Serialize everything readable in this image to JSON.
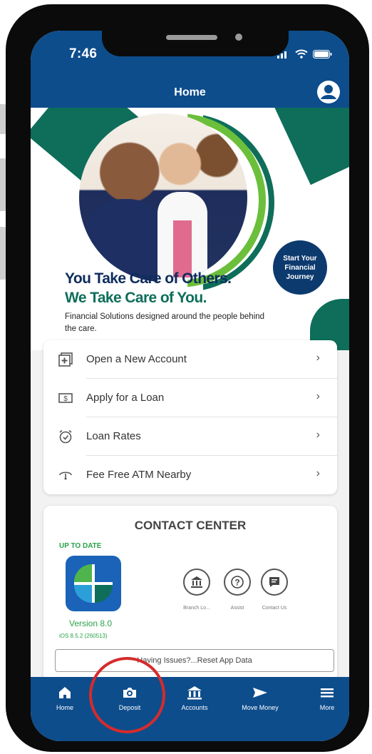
{
  "status_bar": {
    "time": "7:46"
  },
  "header": {
    "title": "Home"
  },
  "hero": {
    "headline_line1": "You Take Care of Others.",
    "headline_line2": "We Take Care of You.",
    "subtitle": "Financial Solutions designed around the people behind the care.",
    "badge_text": "Start Your Financial Journey"
  },
  "quick_links": [
    {
      "label": "Open a New Account",
      "icon": "add-account-icon"
    },
    {
      "label": "Apply for a Loan",
      "icon": "dollar-bill-icon"
    },
    {
      "label": "Loan Rates",
      "icon": "alarm-clock-icon"
    },
    {
      "label": "Fee Free ATM Nearby",
      "icon": "location-icon"
    }
  ],
  "contact_center": {
    "title": "CONTACT CENTER",
    "status": "UP TO DATE",
    "version": "Version 8.0",
    "ios_version": "iOS 8.5.2 (260513)",
    "actions": [
      {
        "label": "Branch Lo...",
        "icon": "bank-icon"
      },
      {
        "label": "Assist",
        "icon": "help-icon"
      },
      {
        "label": "Contact Us",
        "icon": "chat-icon"
      }
    ],
    "reset_label": "Having Issues?...Reset App Data"
  },
  "bottom_nav": [
    {
      "label": "Home",
      "icon": "home-icon"
    },
    {
      "label": "Deposit",
      "icon": "camera-icon"
    },
    {
      "label": "Accounts",
      "icon": "bank-icon"
    },
    {
      "label": "Move Money",
      "icon": "send-icon"
    },
    {
      "label": "More",
      "icon": "menu-icon"
    }
  ],
  "colors": {
    "brand_blue": "#0d4d8c",
    "brand_green": "#0e6e5a",
    "highlight_red": "#d62b2b",
    "status_green": "#2aa34a"
  }
}
